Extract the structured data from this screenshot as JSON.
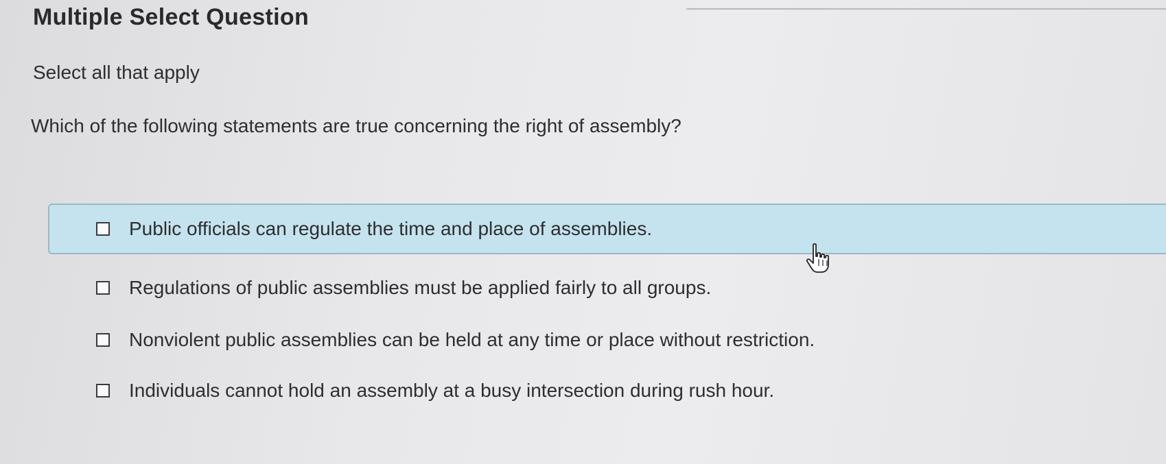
{
  "question": {
    "heading": "Multiple Select Question",
    "instruction": "Select all that apply",
    "prompt": "Which of the following statements are true concerning the right of assembly?"
  },
  "options": [
    {
      "label": "Public officials can regulate the time and place of assemblies.",
      "checked": false,
      "highlighted": true
    },
    {
      "label": "Regulations of public assemblies must be applied fairly to all groups.",
      "checked": false,
      "highlighted": false
    },
    {
      "label": "Nonviolent public assemblies can be held at any time or place without restriction.",
      "checked": false,
      "highlighted": false
    },
    {
      "label": "Individuals cannot hold an assembly at a busy intersection during rush hour.",
      "checked": false,
      "highlighted": false
    }
  ],
  "cursor": {
    "icon": "hand-pointer-icon"
  },
  "colors": {
    "highlight_background": "#c5e3ee",
    "highlight_border": "#9bb8c4",
    "text": "#2e2e31"
  }
}
